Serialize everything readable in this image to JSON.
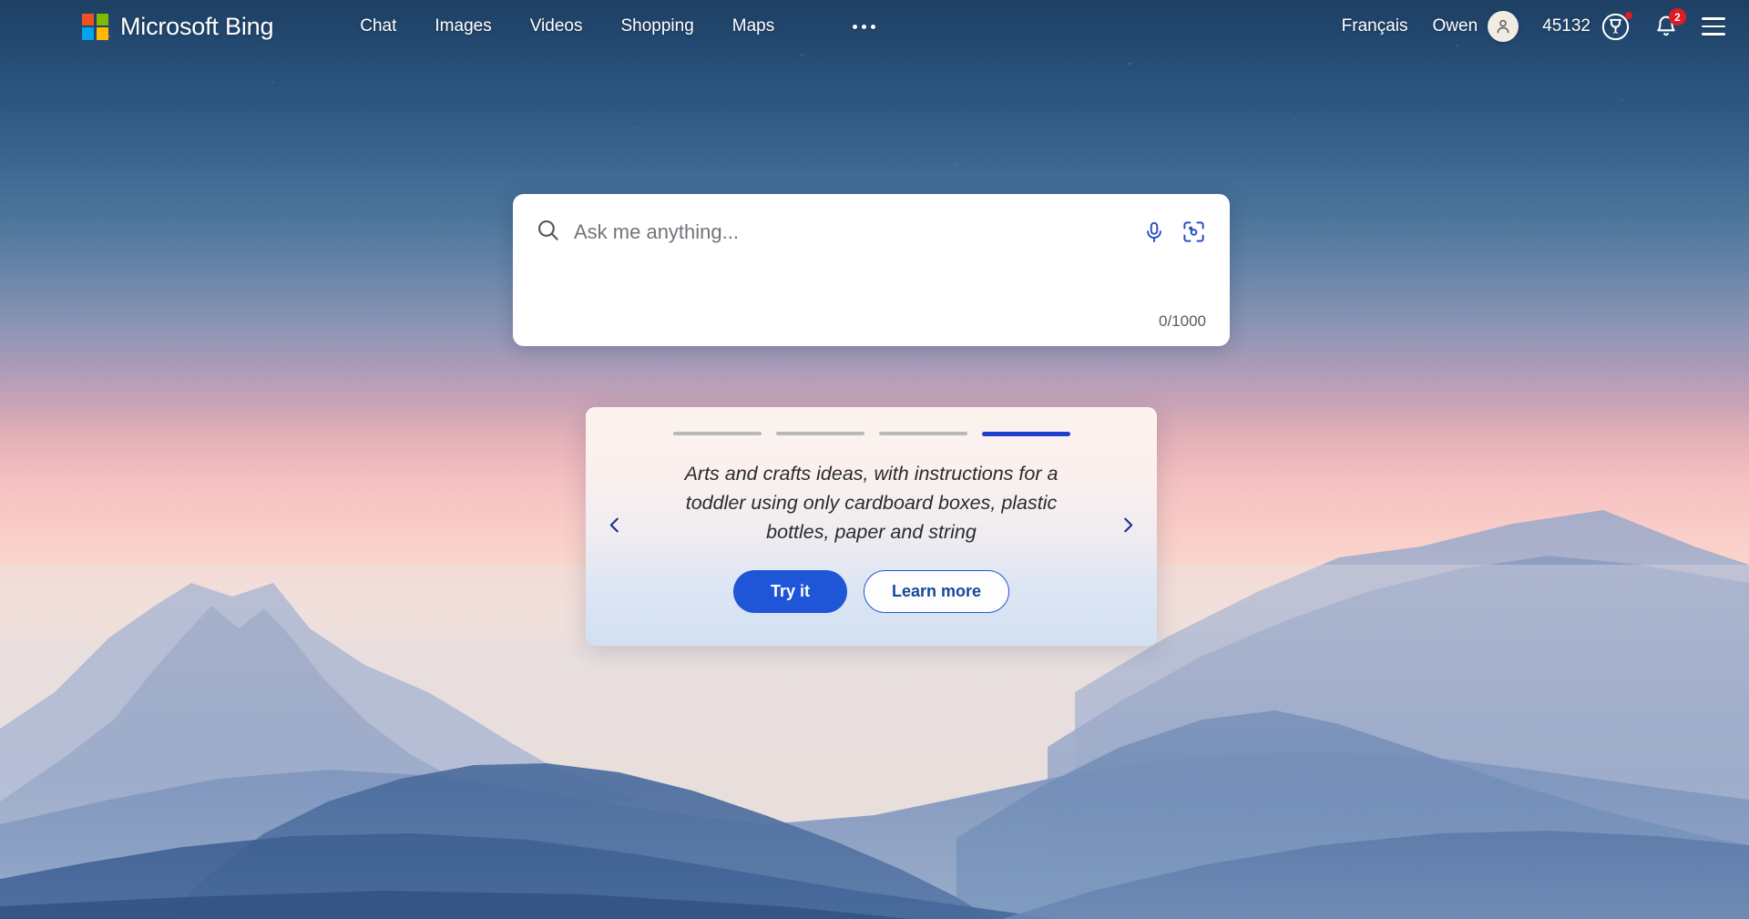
{
  "header": {
    "brand": {
      "name": "Microsoft Bing",
      "logo_icon": "microsoft-logo"
    },
    "nav": [
      {
        "label": "Chat"
      },
      {
        "label": "Images"
      },
      {
        "label": "Videos"
      },
      {
        "label": "Shopping"
      },
      {
        "label": "Maps"
      }
    ],
    "more_label": "...",
    "language": "Français",
    "account": {
      "name": "Owen",
      "avatar_icon": "person-icon"
    },
    "rewards": {
      "points": "45132",
      "icon": "rewards-medal-icon",
      "has_alert_dot": true
    },
    "notifications": {
      "count": "2",
      "icon": "bell-icon"
    },
    "menu": {
      "icon": "hamburger-menu-icon"
    }
  },
  "search": {
    "placeholder": "Ask me anything...",
    "value": "",
    "char_count": "0/1000",
    "search_icon": "search-icon",
    "mic_icon": "microphone-icon",
    "visual_search_icon": "visual-search-icon"
  },
  "promo": {
    "text": "Arts and crafts ideas, with instructions for a toddler using only cardboard boxes, plastic bottles, paper and string",
    "primary_button": "Try it",
    "secondary_button": "Learn more",
    "prev_icon": "chevron-left-icon",
    "next_icon": "chevron-right-icon",
    "pagination": {
      "total": 4,
      "active_index": 3
    }
  },
  "colors": {
    "accent_blue": "#1f56d8",
    "active_bar": "#1f3fcf",
    "badge_red": "#e01b24",
    "ms_red": "#f25022",
    "ms_green": "#7fba00",
    "ms_blue": "#00a4ef",
    "ms_yellow": "#ffb900"
  }
}
